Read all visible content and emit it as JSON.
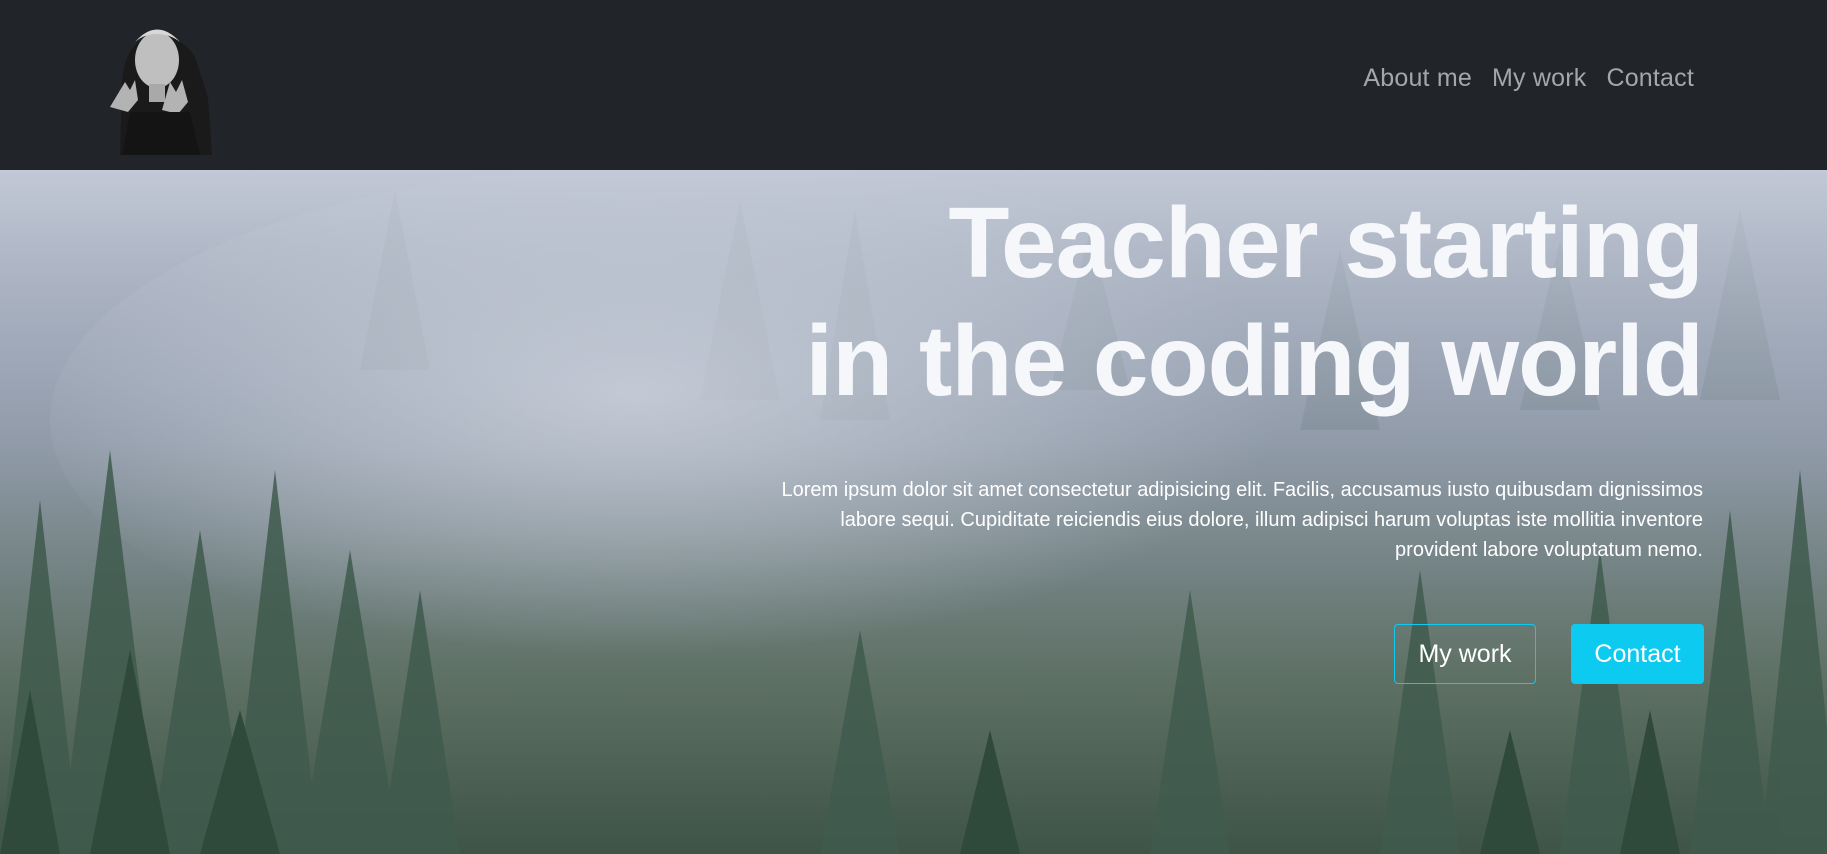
{
  "nav": {
    "links": [
      "About me",
      "My work",
      "Contact"
    ]
  },
  "hero": {
    "title_line1": "Teacher starting",
    "title_line2": "in the coding world",
    "text": "Lorem ipsum dolor sit amet consectetur adipisicing elit. Facilis, accusamus iusto quibusdam dignissimos labore sequi. Cupiditate reiciendis eius dolore, illum adipisci harum voluptas iste mollitia inventore provident labore voluptatum nemo.",
    "buttons": {
      "primary_label": "My work",
      "secondary_label": "Contact"
    }
  },
  "colors": {
    "navbar": "#212529",
    "accent": "#0dcaf0",
    "nav_text": "#a4a7aa"
  },
  "logo": {
    "icon": "statue-avatar-logo"
  }
}
